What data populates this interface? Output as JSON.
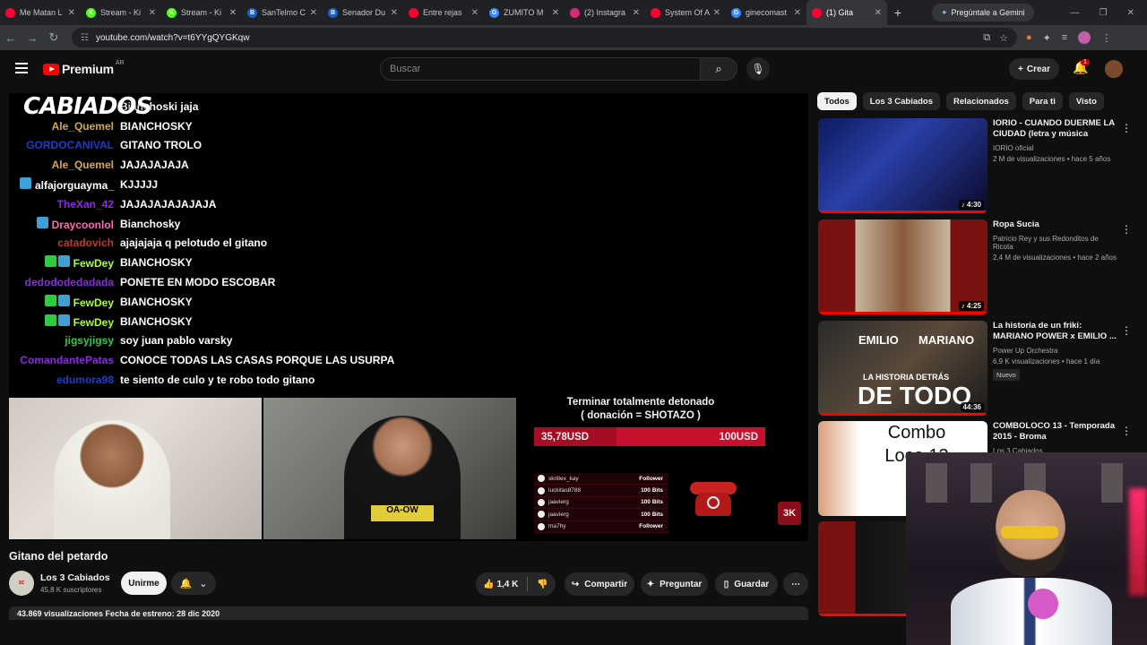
{
  "browser": {
    "tabs": [
      {
        "title": "Me Matan L",
        "color": "#ff0033",
        "glyph": ""
      },
      {
        "title": "Stream - Ki",
        "color": "#53fc18",
        "glyph": "K"
      },
      {
        "title": "Stream - Ki",
        "color": "#53fc18",
        "glyph": "K"
      },
      {
        "title": "SanTelmo C",
        "color": "#1f5fbf",
        "glyph": "B"
      },
      {
        "title": "Senador Du",
        "color": "#1f5fbf",
        "glyph": "B"
      },
      {
        "title": "Entre rejas",
        "color": "#ff0033",
        "glyph": ""
      },
      {
        "title": "ZUMITO M",
        "color": "#4285f4",
        "glyph": "G"
      },
      {
        "title": "(2) Instagra",
        "color": "#d62976",
        "glyph": ""
      },
      {
        "title": "System Of A",
        "color": "#ff0033",
        "glyph": ""
      },
      {
        "title": "ginecomast",
        "color": "#4285f4",
        "glyph": "G"
      },
      {
        "title": "(1) Gita",
        "color": "#ff0033",
        "glyph": "",
        "active": true
      }
    ],
    "new_tab": "+",
    "gemini_label": "Pregúntale a Gemini",
    "url": "youtube.com/watch?v=t6YYgQYGKqw"
  },
  "youtube": {
    "logo_text": "Premium",
    "country": "AR",
    "search_placeholder": "Buscar",
    "create_label": "Crear",
    "notif_count": "1"
  },
  "chat": {
    "overlay_logo": "CABIADOS",
    "messages": [
      {
        "user": "",
        "user_color": "#ffffff",
        "text": "Bianchoski jaja",
        "badges": []
      },
      {
        "user": "Ale_Quemel",
        "user_color": "#d4a84a",
        "text": "BIANCHOSKY",
        "badges": []
      },
      {
        "user": "GORDOCANIVAL",
        "user_color": "#1e3cc8",
        "text": "GITANO TROLO",
        "badges": []
      },
      {
        "user": "Ale_Quemel",
        "user_color": "#d4a84a",
        "text": "JAJAJAJAJA",
        "badges": []
      },
      {
        "user": "alfajorguayma_",
        "user_color": "#ffffff",
        "text": "KJJJJJ",
        "badges": [
          "#3fa0d8"
        ]
      },
      {
        "user": "TheXan_42",
        "user_color": "#8a2be2",
        "text": "JAJAJAJAJAJAJA",
        "badges": []
      },
      {
        "user": "Draycoonlol",
        "user_color": "#ff69b4",
        "text": "Bianchosky",
        "badges": [
          "#3fa0d8"
        ]
      },
      {
        "user": "catadovich",
        "user_color": "#c0392b",
        "text": "ajajajaja q pelotudo el gitano",
        "badges": []
      },
      {
        "user": "FewDey",
        "user_color": "#adff2f",
        "text": "BIANCHOSKY",
        "badges": [
          "#2ecc40",
          "#3fa0d8"
        ]
      },
      {
        "user": "dedododedadada",
        "user_color": "#8a2be2",
        "text": "PONETE EN MODO ESCOBAR",
        "badges": []
      },
      {
        "user": "FewDey",
        "user_color": "#adff2f",
        "text": "BIANCHOSKY",
        "badges": [
          "#2ecc40",
          "#3fa0d8"
        ]
      },
      {
        "user": "FewDey",
        "user_color": "#adff2f",
        "text": "BIANCHOSKY",
        "badges": [
          "#2ecc40",
          "#3fa0d8"
        ]
      },
      {
        "user": "jigsyjigsy",
        "user_color": "#2ecc40",
        "text": "soy juan pablo varsky",
        "badges": []
      },
      {
        "user": "ComandantePatas",
        "user_color": "#8a2be2",
        "text": "CONOCE TODAS LAS CASAS PORQUE LAS USURPA",
        "badges": []
      },
      {
        "user": "edumora98",
        "user_color": "#1e3cc8",
        "text": "te siento de culo y te robo todo gitano",
        "badges": []
      }
    ]
  },
  "stream_overlay": {
    "goal_title_1": "Terminar totalmente detonado",
    "goal_title_2": "( donación = SHOTAZO )",
    "goal_current": "35,78USD",
    "goal_target": "100USD",
    "goal_progress": 0.3578,
    "events": [
      {
        "name": "skrillex_kay",
        "kind": "Follower"
      },
      {
        "name": "luckitas8788",
        "kind": "100 Bits"
      },
      {
        "name": "jaavierg",
        "kind": "100 Bits"
      },
      {
        "name": "jaavierg",
        "kind": "100 Bits"
      },
      {
        "name": "ma7hy",
        "kind": "Follower"
      }
    ],
    "badge_3k": "3K",
    "shirt_text": "OA-OW"
  },
  "video": {
    "title": "Gitano del petardo",
    "channel": "Los 3 Cabiados",
    "subscribers": "45,8 K suscriptores",
    "join_label": "Unirme",
    "likes": "1,4 K",
    "share_label": "Compartir",
    "ask_label": "Preguntar",
    "save_label": "Guardar",
    "views_line": "43.869 visualizaciones  Fecha de estreno: 28 dic 2020"
  },
  "sidebar": {
    "chips": [
      "Todos",
      "Los 3 Cabiados",
      "Relacionados",
      "Para ti",
      "Visto"
    ],
    "recommendations": [
      {
        "title": "IORIO -  CUANDO DUERME LA CIUDAD (letra y música Ricard...",
        "channel": "IORIO oficial",
        "views": "2 M de visualizaciones • hace 5 años",
        "duration": "♪ 4:30",
        "thumb_bg": "linear-gradient(135deg,#0d1a5c 0%,#2a3fa8 40%,#0a0a2a 100%)",
        "new": ""
      },
      {
        "title": "Ropa Sucia",
        "channel": "Patricio Rey y sus Redonditos de Ricota",
        "views": "2,4 M de visualizaciones • hace 2 años",
        "duration": "♪ 4:25",
        "thumb_bg": "linear-gradient(90deg,#7a1212 0%,#7a1212 22%,#c9b7a0 22%,#8a5a3a 50%,#c9b7a0 78%,#7a1212 78%)",
        "new": ""
      },
      {
        "title": "La historia de un friki: MARIANO POWER x EMILIO ...",
        "channel": "Power Up Orchestra",
        "views": "6,9 K visualizaciones • hace 1 día",
        "duration": "44:36",
        "thumb_bg": "linear-gradient(135deg,#2a2a2a 0%,#5a4a3a 50%,#1a1a1a 100%)",
        "new": "Nuevo"
      },
      {
        "title": "COMBOLOCO 13 - Temporada 2015 - Broma",
        "channel": "Los 3 Cabiados",
        "views": "",
        "duration": "",
        "thumb_bg": "linear-gradient(90deg,#d9a07a 0%,#ffffff 25%,#ffffff 100%)",
        "new": ""
      }
    ],
    "thumb_overlay_texts": [
      "EMILIO",
      "MARIANO",
      "LA HISTORIA DETRÁS",
      "DE TODO",
      "Combo",
      "Loco 13"
    ]
  }
}
